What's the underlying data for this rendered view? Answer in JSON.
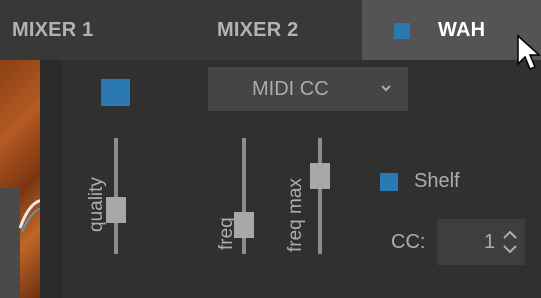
{
  "tabs": [
    {
      "label": "MIXER 1"
    },
    {
      "label": "MIXER 2"
    },
    {
      "label": "WAH",
      "active": true
    }
  ],
  "enable_toggle": {
    "checked": true
  },
  "mode_dropdown": {
    "selected": "MIDI CC"
  },
  "sliders": {
    "quality": {
      "label": "quality",
      "level": 0.35
    },
    "freq": {
      "label": "freq",
      "level": 0.18
    },
    "freq_max": {
      "label": "freq max",
      "level": 0.72
    }
  },
  "shelf": {
    "label": "Shelf",
    "checked": true
  },
  "cc": {
    "label": "CC:",
    "value": "1"
  },
  "colors": {
    "accent": "#2a7ab1",
    "active_tab": "#545454",
    "text": "#a9aeb2"
  }
}
